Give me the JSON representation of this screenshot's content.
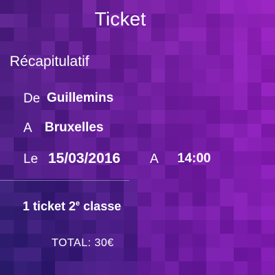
{
  "header": {
    "title": "Ticket"
  },
  "summary": {
    "section_title": "Récapitulatif",
    "from_label": "De",
    "from_value": "Guillemins",
    "to_label": "A",
    "to_value": "Bruxelles",
    "date_label": "Le",
    "date_value": "15/03/2016",
    "time_label": "A",
    "time_value": "14:00"
  },
  "ticket": {
    "count_text": "1 ticket 2",
    "class_ordinal": "e",
    "class_text": " classe"
  },
  "total": {
    "text": "TOTAL: 30€"
  },
  "colors": {
    "text": "#ffffff",
    "background_base": "#5a1e8c",
    "background_accent": "#8a2bb5",
    "background_dark": "#3a1f6a",
    "divider": "#c8aae6"
  }
}
